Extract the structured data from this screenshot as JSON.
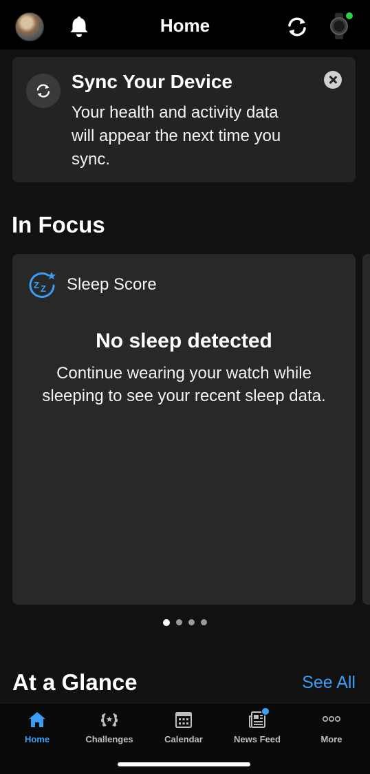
{
  "header": {
    "title": "Home",
    "avatar_icon": "user-avatar",
    "notifications_icon": "bell-icon",
    "sync_icon": "sync-icon",
    "device_icon": "watch-icon",
    "device_status_color": "#2ecc40"
  },
  "sync_card": {
    "title": "Sync Your Device",
    "text": "Your health and activity data will appear the next time you sync.",
    "close_icon": "close-icon"
  },
  "in_focus": {
    "title": "In Focus",
    "card": {
      "label": "Sleep Score",
      "heading": "No sleep detected",
      "body": "Continue wearing your watch while sleeping to see your recent sleep data."
    },
    "pager": {
      "count": 4,
      "active_index": 0
    }
  },
  "at_a_glance": {
    "title": "At a Glance",
    "see_all": "See All"
  },
  "tabbar": {
    "items": [
      {
        "label": "Home",
        "icon": "home-icon",
        "active": true
      },
      {
        "label": "Challenges",
        "icon": "laurel-icon",
        "active": false
      },
      {
        "label": "Calendar",
        "icon": "calendar-icon",
        "active": false
      },
      {
        "label": "News Feed",
        "icon": "news-icon",
        "active": false,
        "badge": true
      },
      {
        "label": "More",
        "icon": "more-icon",
        "active": false
      }
    ]
  },
  "colors": {
    "accent": "#3b9ef5",
    "background": "#111111",
    "card": "#282828"
  }
}
